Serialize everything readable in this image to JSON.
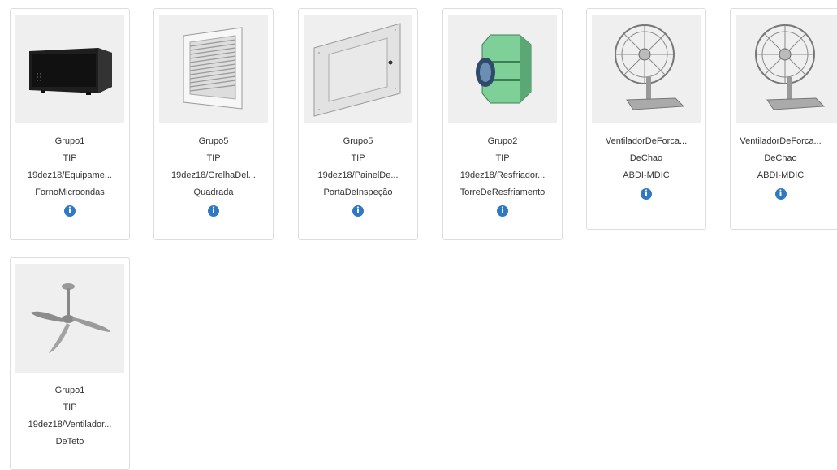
{
  "cards": [
    {
      "lines": [
        "Grupo1",
        "TIP",
        "19dez18/Equipame...",
        "FornoMicroondas"
      ],
      "icon": "info-icon",
      "image": "microwave-oven"
    },
    {
      "lines": [
        "Grupo5",
        "TIP",
        "19dez18/GrelhaDel...",
        "Quadrada"
      ],
      "icon": "info-icon",
      "image": "square-grille"
    },
    {
      "lines": [
        "Grupo5",
        "TIP",
        "19dez18/PainelDe...",
        "PortaDeInspeção"
      ],
      "icon": "info-icon",
      "image": "inspection-panel"
    },
    {
      "lines": [
        "Grupo2",
        "TIP",
        "19dez18/Resfriador...",
        "TorreDeResfriamento"
      ],
      "icon": "info-icon",
      "image": "cooling-tower"
    },
    {
      "lines": [
        "VentiladorDeForca...",
        "DeChao",
        "ABDI-MDIC"
      ],
      "icon": "info-icon",
      "image": "floor-fan"
    },
    {
      "lines": [
        "VentiladorDeForca...",
        "DeChao",
        "ABDI-MDIC"
      ],
      "icon": "info-icon",
      "image": "floor-fan"
    },
    {
      "lines": [
        "Grupo1",
        "TIP",
        "19dez18/Ventilador...",
        "DeTeto"
      ],
      "icon": "info-icon",
      "image": "ceiling-fan"
    }
  ],
  "colors": {
    "info": "#2f78c4",
    "border": "#dddddd",
    "thumb_bg": "#efefef"
  }
}
